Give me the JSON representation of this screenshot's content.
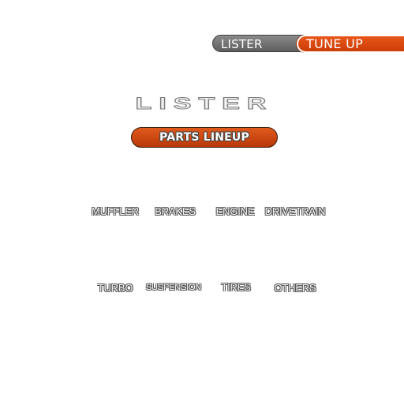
{
  "header": {
    "maker_tab": "LISTER",
    "mode_tab": "TUNE UP"
  },
  "brand": {
    "logo_text": "LISTER"
  },
  "section": {
    "title": "PARTS LINEUP"
  },
  "parts": {
    "row1": [
      "MUFFLER",
      "BRAKES",
      "ENGINE",
      "DRIVETRAIN"
    ],
    "row2": [
      "TURBO",
      "SUSPENSION",
      "TIRES",
      "OTHERS"
    ]
  },
  "colors": {
    "accent_orange": "#d9480f",
    "tab_gray": "#6e6e6e",
    "background": "#ffffff"
  }
}
